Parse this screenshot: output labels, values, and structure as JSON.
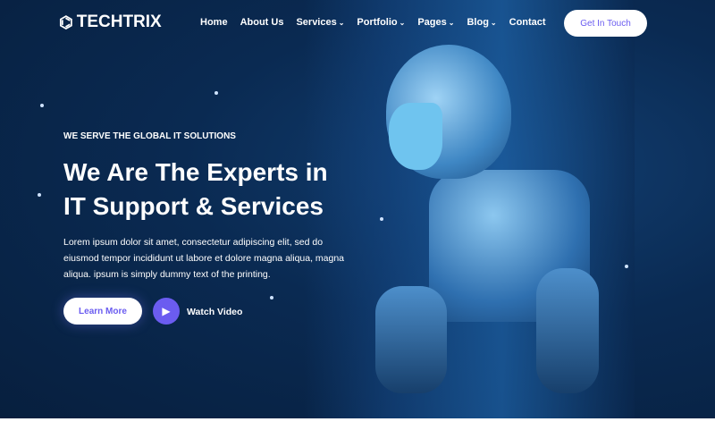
{
  "brand": {
    "name": "TECHTRIX",
    "icon": "molecule-icon"
  },
  "nav": {
    "items": [
      {
        "label": "Home",
        "dropdown": false
      },
      {
        "label": "About Us",
        "dropdown": false
      },
      {
        "label": "Services",
        "dropdown": true
      },
      {
        "label": "Portfolio",
        "dropdown": true
      },
      {
        "label": "Pages",
        "dropdown": true
      },
      {
        "label": "Blog",
        "dropdown": true
      },
      {
        "label": "Contact",
        "dropdown": false
      }
    ],
    "cta": "Get In Touch"
  },
  "hero": {
    "tagline": "WE SERVE THE GLOBAL IT SOLUTIONS",
    "title_line1": "We Are The Experts in",
    "title_line2": "IT Support & Services",
    "description": "Lorem ipsum dolor sit amet, consectetur adipiscing elit, sed do eiusmod tempor incididunt ut labore et dolore magna aliqua, magna aliqua. ipsum is simply dummy text of the printing.",
    "learn_more": "Learn More",
    "watch_video": "Watch Video"
  },
  "colors": {
    "accent": "#6b5cf0",
    "background": "#0a2a52"
  }
}
